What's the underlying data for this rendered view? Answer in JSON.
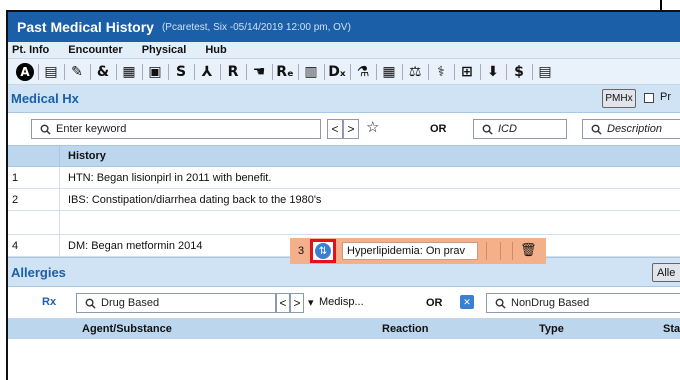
{
  "window": {
    "title": "Past Medical History",
    "subtitle": "(Pcaretest, Six -05/14/2019 12:00 pm, OV)"
  },
  "menu": [
    "Pt. Info",
    "Encounter",
    "Physical",
    "Hub"
  ],
  "toolbar": {
    "icons": [
      {
        "name": "a-badge-icon",
        "glyph": "A"
      },
      {
        "name": "clipboard-icon",
        "glyph": "▤"
      },
      {
        "name": "pill-icon",
        "glyph": "✎"
      },
      {
        "name": "ampersand-icon",
        "glyph": "&"
      },
      {
        "name": "note-icon",
        "glyph": "▦"
      },
      {
        "name": "form-icon",
        "glyph": "▣"
      },
      {
        "name": "s-icon",
        "glyph": "S"
      },
      {
        "name": "procedure-icon",
        "glyph": "⅄"
      },
      {
        "name": "r-icon",
        "glyph": "R"
      },
      {
        "name": "hand-icon",
        "glyph": "☚"
      },
      {
        "name": "re-icon",
        "glyph": "Rₑ"
      },
      {
        "name": "doc-icon",
        "glyph": "▥"
      },
      {
        "name": "dx-icon",
        "glyph": "Dₓ"
      },
      {
        "name": "rx-bottle-icon",
        "glyph": "⚗"
      },
      {
        "name": "grid-icon",
        "glyph": "▦"
      },
      {
        "name": "lab-icon",
        "glyph": "⚖"
      },
      {
        "name": "vitals-icon",
        "glyph": "⚕"
      },
      {
        "name": "plus-box-icon",
        "glyph": "⊞"
      },
      {
        "name": "pin-icon",
        "glyph": "⬇"
      },
      {
        "name": "billing-icon",
        "glyph": "$"
      },
      {
        "name": "list-icon",
        "glyph": "▤"
      }
    ]
  },
  "medical_hx": {
    "title": "Medical Hx",
    "pmhx_label": "PMHx",
    "checkbox_label": "Pr",
    "search": {
      "keyword_placeholder": "Enter keyword",
      "prev": "<",
      "next": ">",
      "star": "☆",
      "or_label": "OR",
      "icd_placeholder": "ICD",
      "description_placeholder": "Description"
    },
    "table_header": "History",
    "rows": [
      {
        "num": "1",
        "text": "HTN: Began lisionpirl in 2011 with benefit."
      },
      {
        "num": "2",
        "text": "IBS: Constipation/diarrhea dating back to the 1980's"
      },
      {
        "num": "",
        "text": ""
      },
      {
        "num": "4",
        "text": "DM: Began metformin 2014"
      }
    ],
    "dragged_row": {
      "num": "3",
      "text": "Hyperlipidemia: On prav"
    }
  },
  "allergies": {
    "title": "Allergies",
    "button_label": "Alle",
    "rx_label": "Rx",
    "drug_placeholder": "Drug Based",
    "prev": "<",
    "next": ">",
    "dropdown_arrow": "▾",
    "source": "Medisp...",
    "or_label": "OR",
    "nondrug_placeholder": "NonDrug Based",
    "columns": [
      "Agent/Substance",
      "Reaction",
      "Type",
      "Sta"
    ]
  },
  "colors": {
    "title_bar": "#1b5fa8",
    "section_header": "#cfe3f4",
    "table_header": "#bcd6ee",
    "drag_row": "#f3b08a",
    "highlight_border": "#e4101d"
  }
}
